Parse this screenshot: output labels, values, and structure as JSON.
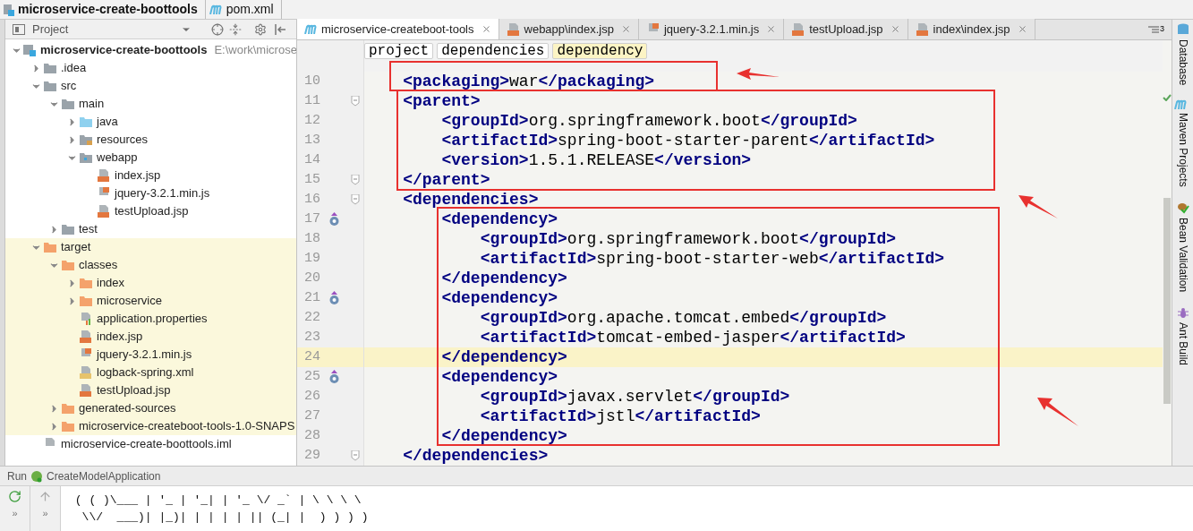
{
  "breadcrumb": [
    {
      "label": "microservice-create-boottools",
      "kind": "project"
    },
    {
      "label": "pom.xml",
      "kind": "maven"
    }
  ],
  "project_panel": {
    "title": "Project",
    "tree": [
      {
        "label": "microservice-create-boottools",
        "path": "E:\\work\\microse",
        "kind": "module",
        "expanded": true,
        "excluded": false,
        "children": [
          {
            "label": ".idea",
            "kind": "folder",
            "expanded": false,
            "excluded": false
          },
          {
            "label": "src",
            "kind": "folder",
            "expanded": true,
            "excluded": false,
            "children": [
              {
                "label": "main",
                "kind": "folder",
                "expanded": true,
                "excluded": false,
                "children": [
                  {
                    "label": "java",
                    "kind": "source",
                    "expanded": false,
                    "excluded": false
                  },
                  {
                    "label": "resources",
                    "kind": "resources",
                    "expanded": false,
                    "excluded": false
                  },
                  {
                    "label": "webapp",
                    "kind": "web",
                    "expanded": true,
                    "excluded": false,
                    "children": [
                      {
                        "label": "index.jsp",
                        "kind": "jsp",
                        "excluded": false
                      },
                      {
                        "label": "jquery-3.2.1.min.js",
                        "kind": "js",
                        "excluded": false
                      },
                      {
                        "label": "testUpload.jsp",
                        "kind": "jsp",
                        "excluded": false
                      }
                    ]
                  }
                ]
              },
              {
                "label": "test",
                "kind": "folder",
                "expanded": false,
                "excluded": false
              }
            ]
          },
          {
            "label": "target",
            "kind": "folder",
            "expanded": true,
            "excluded": true,
            "children": [
              {
                "label": "classes",
                "kind": "folder",
                "expanded": true,
                "excluded": true,
                "children": [
                  {
                    "label": "index",
                    "kind": "folder",
                    "expanded": false,
                    "excluded": true
                  },
                  {
                    "label": "microservice",
                    "kind": "folder",
                    "expanded": false,
                    "excluded": true
                  },
                  {
                    "label": "application.properties",
                    "kind": "properties",
                    "excluded": true
                  },
                  {
                    "label": "index.jsp",
                    "kind": "jsp",
                    "excluded": true
                  },
                  {
                    "label": "jquery-3.2.1.min.js",
                    "kind": "js",
                    "excluded": true
                  },
                  {
                    "label": "logback-spring.xml",
                    "kind": "xml",
                    "excluded": true
                  },
                  {
                    "label": "testUpload.jsp",
                    "kind": "jsp",
                    "excluded": true
                  }
                ]
              },
              {
                "label": "generated-sources",
                "kind": "folder",
                "expanded": false,
                "excluded": true
              },
              {
                "label": "microservice-createboot-tools-1.0-SNAPS",
                "kind": "folder",
                "expanded": false,
                "excluded": true
              }
            ]
          },
          {
            "label": "microservice-create-boottools.iml",
            "kind": "iml",
            "excluded": false
          }
        ]
      }
    ]
  },
  "editor": {
    "tabs": [
      {
        "label": "microservice-createboot-tools",
        "kind": "maven",
        "selected": true
      },
      {
        "label": "webapp\\index.jsp",
        "kind": "jsp",
        "selected": false
      },
      {
        "label": "jquery-3.2.1.min.js",
        "kind": "js",
        "selected": false
      },
      {
        "label": "testUpload.jsp",
        "kind": "jsp",
        "selected": false
      },
      {
        "label": "index\\index.jsp",
        "kind": "jsp",
        "selected": false
      }
    ],
    "tab_count": "3",
    "crumbs": [
      {
        "label": "project",
        "selected": false
      },
      {
        "label": "dependencies",
        "selected": false
      },
      {
        "label": "dependency",
        "selected": true
      }
    ],
    "lines": [
      {
        "number": "10",
        "text": "    <packaging>war</packaging>",
        "current": false
      },
      {
        "number": "11",
        "text": "    <parent>",
        "kind": "fold",
        "current": false
      },
      {
        "number": "12",
        "text": "        <groupId>org.springframework.boot</groupId>",
        "current": false
      },
      {
        "number": "13",
        "text": "        <artifactId>spring-boot-starter-parent</artifactId>",
        "current": false
      },
      {
        "number": "14",
        "text": "        <version>1.5.1.RELEASE</version>",
        "current": false
      },
      {
        "number": "15",
        "text": "    </parent>",
        "kind": "fold",
        "current": false
      },
      {
        "number": "16",
        "text": "    <dependencies>",
        "kind": "fold",
        "current": false
      },
      {
        "number": "17",
        "text": "        <dependency>",
        "kind": "override",
        "current": false
      },
      {
        "number": "18",
        "text": "            <groupId>org.springframework.boot</groupId>",
        "current": false
      },
      {
        "number": "19",
        "text": "            <artifactId>spring-boot-starter-web</artifactId>",
        "current": false
      },
      {
        "number": "20",
        "text": "        </dependency>",
        "current": false
      },
      {
        "number": "21",
        "text": "        <dependency>",
        "kind": "override",
        "current": false
      },
      {
        "number": "22",
        "text": "            <groupId>org.apache.tomcat.embed</groupId>",
        "current": false
      },
      {
        "number": "23",
        "text": "            <artifactId>tomcat-embed-jasper</artifactId>",
        "current": false
      },
      {
        "number": "24",
        "text": "        </dependency>",
        "current": true
      },
      {
        "number": "25",
        "text": "        <dependency>",
        "kind": "override",
        "current": false
      },
      {
        "number": "26",
        "text": "            <groupId>javax.servlet</groupId>",
        "current": false
      },
      {
        "number": "27",
        "text": "            <artifactId>jstl</artifactId>",
        "current": false
      },
      {
        "number": "28",
        "text": "        </dependency>",
        "current": false
      },
      {
        "number": "29",
        "text": "    </dependencies>",
        "kind": "fold",
        "current": false
      }
    ]
  },
  "tool_windows": [
    {
      "label": "Database",
      "kind": "database"
    },
    {
      "label": "Maven Projects",
      "kind": "maven"
    },
    {
      "label": "Bean Validation",
      "kind": "bean"
    },
    {
      "label": "Ant Build",
      "kind": "ant"
    }
  ],
  "run_panel": {
    "title": "Run",
    "config": "CreateModelApplication",
    "toolbar": [
      {
        "label": "»"
      },
      {
        "label": "»"
      }
    ],
    "console": [
      " ( ( )\\___ | '_ | '_| | '_ \\/ _` | \\ \\ \\ \\",
      "  \\\\/  ___)| |_)| | | | | || (_| |  ) ) ) )"
    ]
  }
}
